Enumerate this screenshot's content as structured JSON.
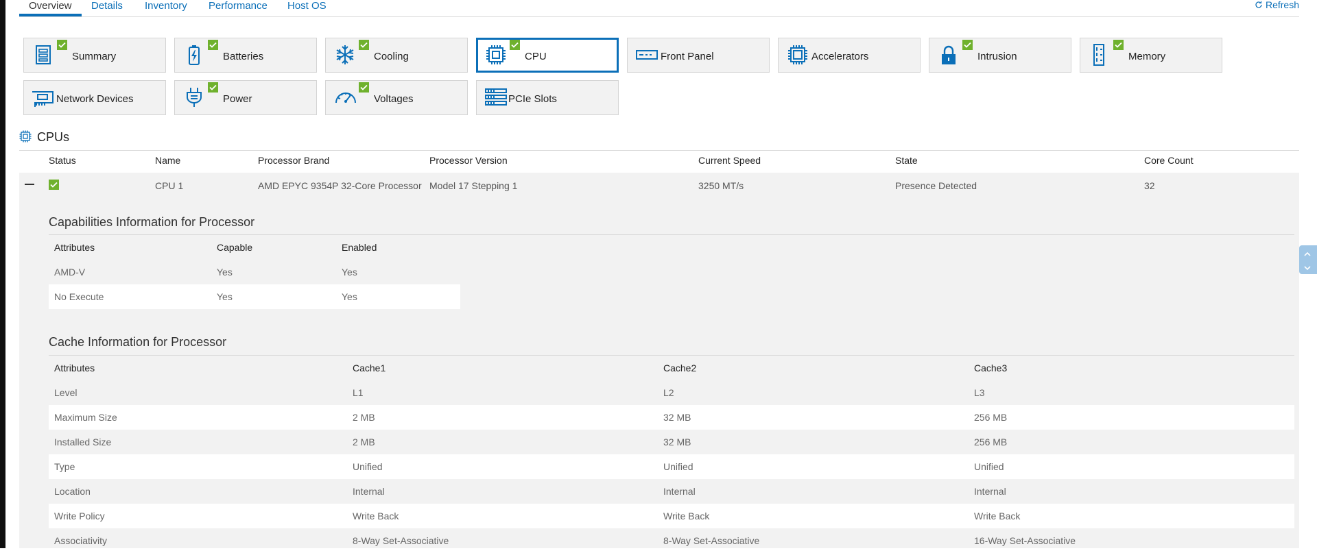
{
  "tabs": [
    {
      "label": "Overview",
      "active": true
    },
    {
      "label": "Details",
      "active": false
    },
    {
      "label": "Inventory",
      "active": false
    },
    {
      "label": "Performance",
      "active": false
    },
    {
      "label": "Host OS",
      "active": false
    }
  ],
  "refresh_label": "Refresh",
  "accent_color": "#0b6fb8",
  "status_ok_color": "#6fb12d",
  "tiles": [
    {
      "label": "Summary",
      "icon": "summary-icon",
      "check": true
    },
    {
      "label": "Batteries",
      "icon": "battery-icon",
      "check": true
    },
    {
      "label": "Cooling",
      "icon": "snowflake-icon",
      "check": true
    },
    {
      "label": "CPU",
      "icon": "chip-icon",
      "check": true,
      "selected": true
    },
    {
      "label": "Front Panel",
      "icon": "front-panel-icon",
      "check": false
    },
    {
      "label": "Accelerators",
      "icon": "accelerator-icon",
      "check": false
    },
    {
      "label": "Intrusion",
      "icon": "lock-icon",
      "check": true
    },
    {
      "label": "Memory",
      "icon": "memory-icon",
      "check": true
    },
    {
      "label": "Network Devices",
      "icon": "network-card-icon",
      "check": false
    },
    {
      "label": "Power",
      "icon": "plug-icon",
      "check": true
    },
    {
      "label": "Voltages",
      "icon": "gauge-icon",
      "check": true
    },
    {
      "label": "PCIe Slots",
      "icon": "pcie-slots-icon",
      "check": false
    }
  ],
  "cpus": {
    "title": "CPUs",
    "headers": {
      "status": "Status",
      "name": "Name",
      "brand": "Processor Brand",
      "version": "Processor Version",
      "speed": "Current Speed",
      "state": "State",
      "cores": "Core Count"
    },
    "row": {
      "status": "ok",
      "name": "CPU 1",
      "brand": "AMD EPYC 9354P 32-Core Processor",
      "version": "Model 17 Stepping 1",
      "speed": "3250 MT/s",
      "state": "Presence Detected",
      "cores": "32"
    }
  },
  "capabilities": {
    "title": "Capabilities Information for Processor",
    "headers": [
      "Attributes",
      "Capable",
      "Enabled"
    ],
    "rows": [
      [
        "AMD-V",
        "Yes",
        "Yes"
      ],
      [
        "No Execute",
        "Yes",
        "Yes"
      ]
    ]
  },
  "cache": {
    "title": "Cache Information for Processor",
    "headers": [
      "Attributes",
      "Cache1",
      "Cache2",
      "Cache3"
    ],
    "rows": [
      [
        "Level",
        "L1",
        "L2",
        "L3"
      ],
      [
        "Maximum Size",
        "2 MB",
        "32 MB",
        "256 MB"
      ],
      [
        "Installed Size",
        "2 MB",
        "32 MB",
        "256 MB"
      ],
      [
        "Type",
        "Unified",
        "Unified",
        "Unified"
      ],
      [
        "Location",
        "Internal",
        "Internal",
        "Internal"
      ],
      [
        "Write Policy",
        "Write Back",
        "Write Back",
        "Write Back"
      ],
      [
        "Associativity",
        "8-Way Set-Associative",
        "8-Way Set-Associative",
        "16-Way Set-Associative"
      ]
    ]
  }
}
